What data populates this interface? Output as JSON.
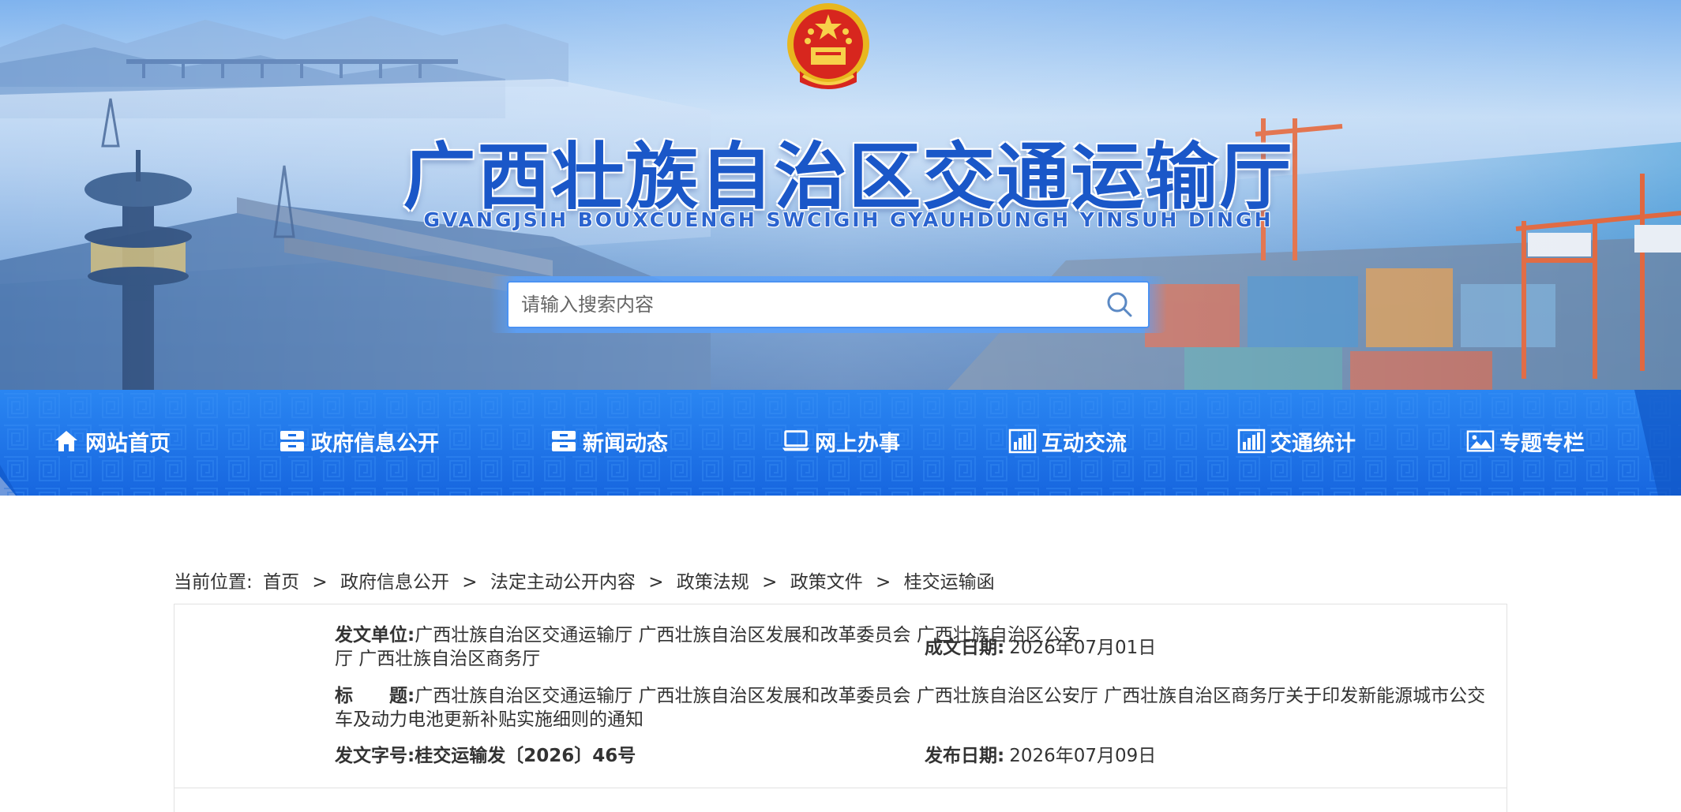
{
  "header": {
    "site_title": "广西壮族自治区交通运输厅",
    "site_subtitle": "GVANGJSIH BOUXCUENGH SWCIGIH GYAUHDUNGH YINSUH DINGH",
    "emblem_icon": "national-emblem-icon",
    "search": {
      "placeholder": "请输入搜索内容",
      "value": "",
      "icon": "search-icon"
    }
  },
  "nav": {
    "items": [
      {
        "label": "网站首页",
        "icon": "home-icon"
      },
      {
        "label": "政府信息公开",
        "icon": "archive-icon"
      },
      {
        "label": "新闻动态",
        "icon": "archive-icon"
      },
      {
        "label": "网上办事",
        "icon": "laptop-icon"
      },
      {
        "label": "互动交流",
        "icon": "bar-chart-icon"
      },
      {
        "label": "交通统计",
        "icon": "bar-chart-icon"
      },
      {
        "label": "专题专栏",
        "icon": "picture-icon"
      }
    ],
    "colors": {
      "nav_bg": "#1a6fe6",
      "nav_text": "#ffffff"
    }
  },
  "breadcrumb": {
    "prefix": "当前位置:",
    "items": [
      "首页",
      "政府信息公开",
      "法定主动公开内容",
      "政策法规",
      "政策文件",
      "桂交运输函"
    ],
    "separator": ">"
  },
  "document_info": {
    "issuer_label": "发文单位:",
    "issuer_value": "广西壮族自治区交通运输厅 广西壮族自治区发展和改革委员会 广西壮族自治区公安厅 广西壮族自治区商务厅",
    "created_label": "成文日期:",
    "created_value": "2026年07月01日",
    "title_label": "标　　题:",
    "title_value": "广西壮族自治区交通运输厅 广西壮族自治区发展和改革委员会 广西壮族自治区公安厅 广西壮族自治区商务厅关于印发新能源城市公交车及动力电池更新补贴实施细则的通知",
    "docno_label": "发文字号:",
    "docno_value": "桂交运输发〔2026〕46号",
    "published_label": "发布日期:",
    "published_value": "2026年07月09日"
  }
}
